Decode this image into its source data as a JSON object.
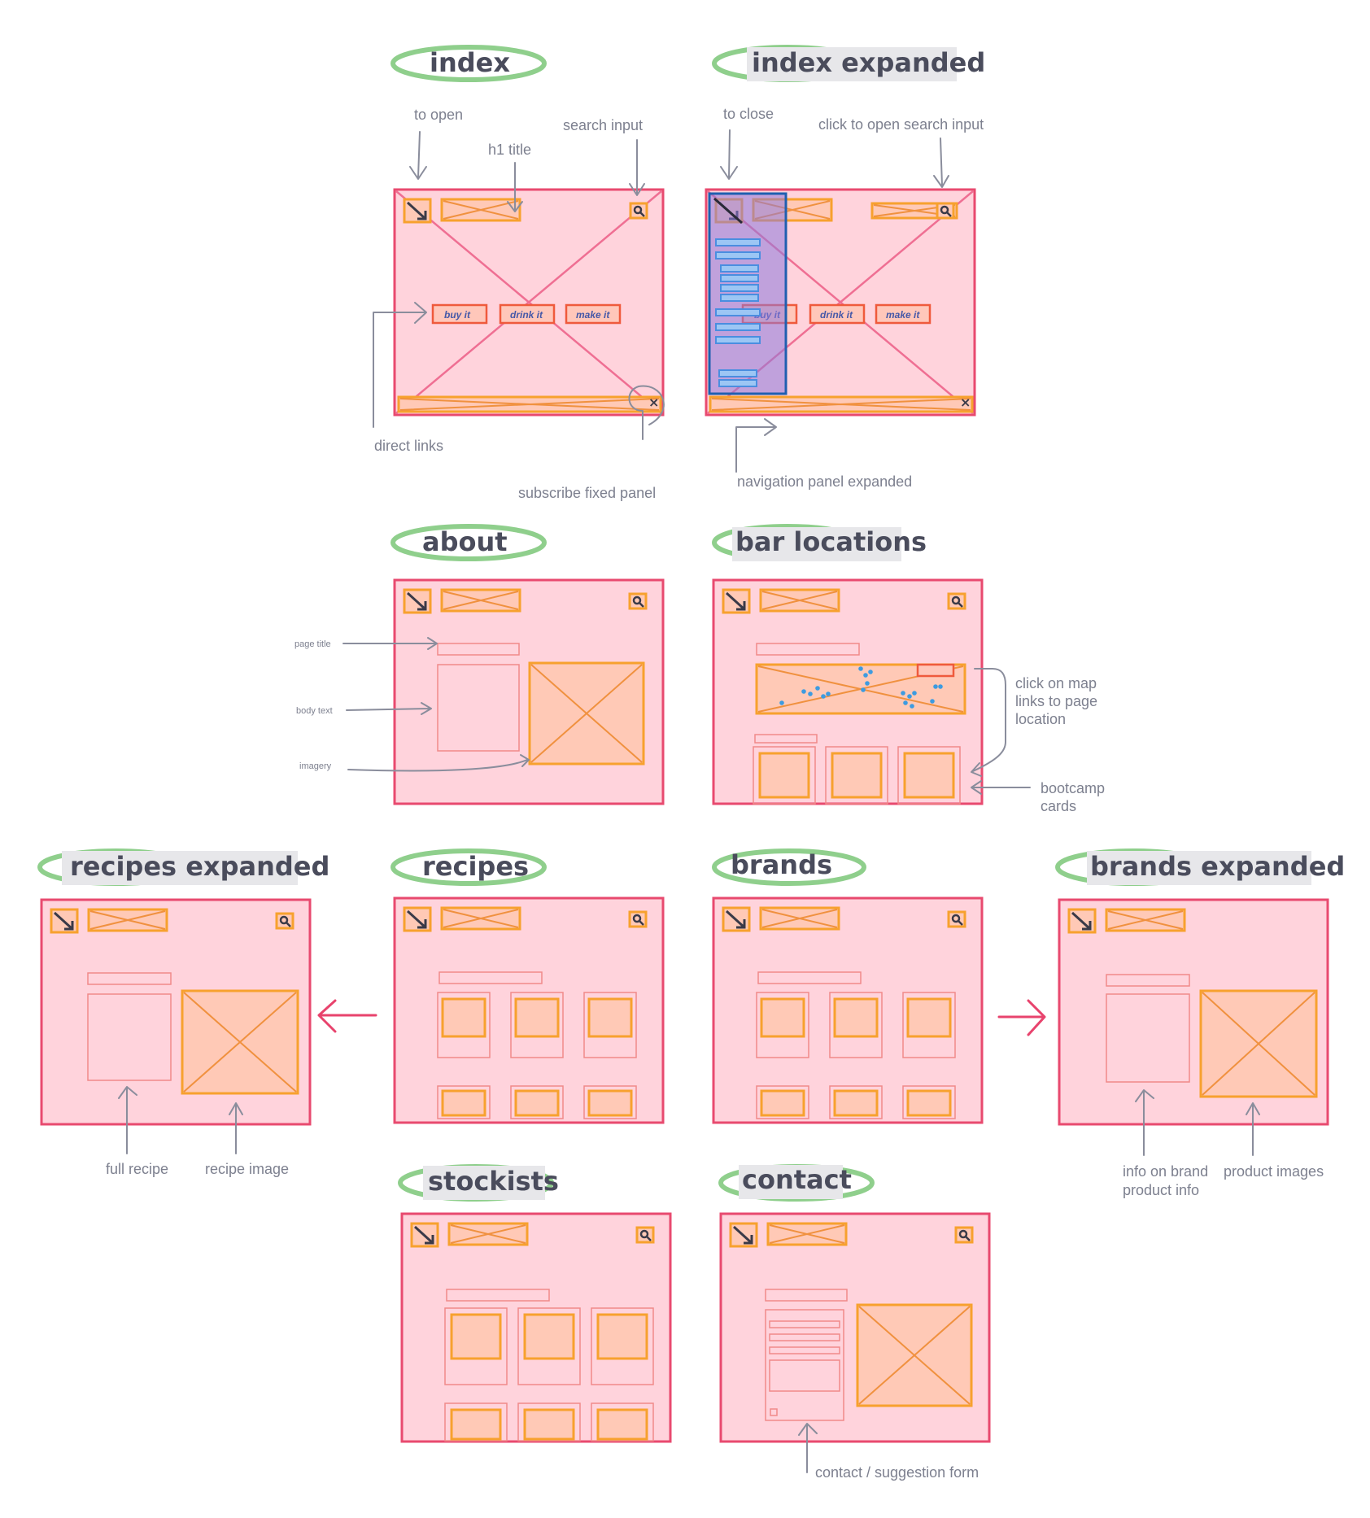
{
  "screens": {
    "index": {
      "title": "index"
    },
    "index_expanded": {
      "title": "index expanded"
    },
    "about": {
      "title": "about"
    },
    "bar_locations": {
      "title": "bar locations"
    },
    "recipes_expanded": {
      "title": "recipes expanded"
    },
    "recipes": {
      "title": "recipes"
    },
    "brands": {
      "title": "brands"
    },
    "brands_expanded": {
      "title": "brands expanded"
    },
    "stockists": {
      "title": "stockists"
    },
    "contact": {
      "title": "contact"
    }
  },
  "buttons": {
    "buy": "buy it",
    "drink": "drink it",
    "make": "make it"
  },
  "annotations": {
    "to_open": "to open",
    "h1_title": "h1 title",
    "search_input": "search input",
    "direct_links": "direct links",
    "subscribe_fixed_panel": "subscribe fixed panel",
    "to_close": "to close",
    "click_open_search": "click to open search input",
    "nav_panel_expanded": "navigation panel expanded",
    "page_title": "page title",
    "body_text": "body text",
    "imagery": "imagery",
    "click_map_1": "click on map",
    "click_map_2": "links to page",
    "click_map_3": "location",
    "bootcamp_1": "bootcamp",
    "bootcamp_2": "cards",
    "full_recipe": "full recipe",
    "recipe_image": "recipe image",
    "info_brand_1": "info on brand",
    "info_brand_2": "product info",
    "product_images": "product images",
    "contact_form": "contact / suggestion form"
  },
  "colors": {
    "frame_fill": "#ffd3dc",
    "frame_stroke": "#e84a6f",
    "accent_orange": "#f7a12e",
    "title_oval": "#8fcf8c",
    "nav_blue": "#1f5fb0"
  },
  "icons": [
    "hamburger-arrow-icon",
    "search-icon",
    "close-icon"
  ]
}
